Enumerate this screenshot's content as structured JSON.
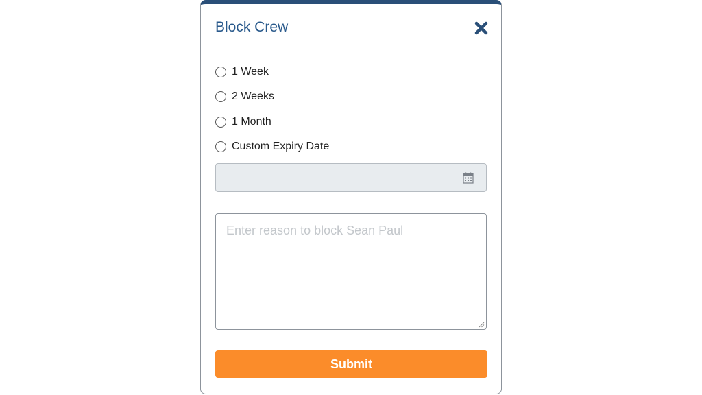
{
  "dialog": {
    "title": "Block Crew",
    "close_icon": "close-x-icon"
  },
  "duration_options": [
    {
      "label": "1 Week",
      "selected": false
    },
    {
      "label": "2 Weeks",
      "selected": false
    },
    {
      "label": "1 Month",
      "selected": false
    },
    {
      "label": "Custom Expiry Date",
      "selected": false
    }
  ],
  "expiry_date": {
    "value": "",
    "icon": "calendar-icon",
    "disabled": true
  },
  "reason": {
    "value": "",
    "placeholder": "Enter reason to block Sean Paul"
  },
  "submit_label": "Submit",
  "colors": {
    "header_bar": "#2a4f78",
    "title": "#2a5a8c",
    "submit": "#fb8c2a",
    "date_field_bg": "#e8ecef"
  }
}
